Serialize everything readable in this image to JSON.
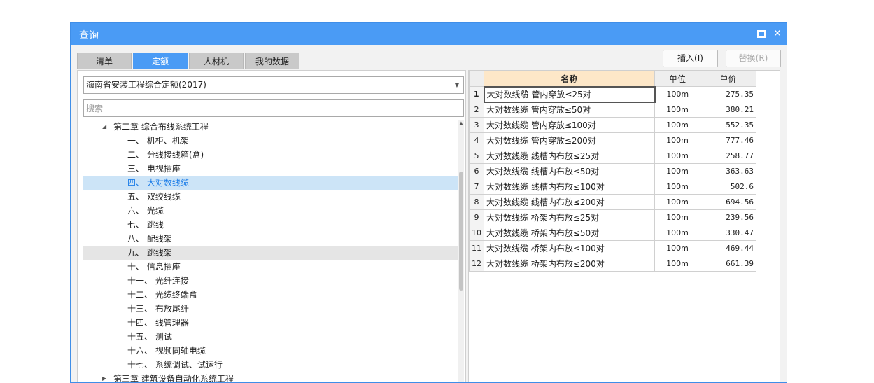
{
  "dialog": {
    "title": "查询",
    "maximize_label": "",
    "close_label": "✕"
  },
  "tabs": [
    {
      "label": "清单",
      "active": false
    },
    {
      "label": "定额",
      "active": true
    },
    {
      "label": "人材机",
      "active": false
    },
    {
      "label": "我的数据",
      "active": false
    }
  ],
  "actions": {
    "insert_label": "插入(I)",
    "replace_label": "替换(R)"
  },
  "library_select": {
    "value": "海南省安装工程综合定额(2017)"
  },
  "search": {
    "placeholder": "搜索"
  },
  "tree": {
    "chapter2": "第二章 综合布线系统工程",
    "items": [
      "一、 机柜、机架",
      "二、 分线接线箱(盒)",
      "三、 电视插座",
      "四、 大对数线缆",
      "五、 双绞线缆",
      "六、 光缆",
      "七、 跳线",
      "八、 配线架",
      "九、 跳线架",
      "十、 信息插座",
      "十一、 光纤连接",
      "十二、 光缆终端盒",
      "十三、 布放尾纤",
      "十四、 线管理器",
      "十五、 测试",
      "十六、 视频同轴电缆",
      "十七、 系统调试、试运行"
    ],
    "chapter3": "第三章 建筑设备自动化系统工程"
  },
  "grid": {
    "headers": {
      "name": "名称",
      "unit": "单位",
      "price": "单价"
    },
    "rows": [
      {
        "idx": "1",
        "name": "大对数线缆 管内穿放≤25对",
        "unit": "100m",
        "price": "275.35"
      },
      {
        "idx": "2",
        "name": "大对数线缆 管内穿放≤50对",
        "unit": "100m",
        "price": "380.21"
      },
      {
        "idx": "3",
        "name": "大对数线缆 管内穿放≤100对",
        "unit": "100m",
        "price": "552.35"
      },
      {
        "idx": "4",
        "name": "大对数线缆 管内穿放≤200对",
        "unit": "100m",
        "price": "777.46"
      },
      {
        "idx": "5",
        "name": "大对数线缆 线槽内布放≤25对",
        "unit": "100m",
        "price": "258.77"
      },
      {
        "idx": "6",
        "name": "大对数线缆 线槽内布放≤50对",
        "unit": "100m",
        "price": "363.63"
      },
      {
        "idx": "7",
        "name": "大对数线缆 线槽内布放≤100对",
        "unit": "100m",
        "price": "502.6"
      },
      {
        "idx": "8",
        "name": "大对数线缆 线槽内布放≤200对",
        "unit": "100m",
        "price": "694.56"
      },
      {
        "idx": "9",
        "name": "大对数线缆 桥架内布放≤25对",
        "unit": "100m",
        "price": "239.56"
      },
      {
        "idx": "10",
        "name": "大对数线缆 桥架内布放≤50对",
        "unit": "100m",
        "price": "330.47"
      },
      {
        "idx": "11",
        "name": "大对数线缆 桥架内布放≤100对",
        "unit": "100m",
        "price": "469.44"
      },
      {
        "idx": "12",
        "name": "大对数线缆 桥架内布放≤200对",
        "unit": "100m",
        "price": "661.39"
      }
    ]
  },
  "colors": {
    "titlebar": "#4a9bf5",
    "active_tab": "#4a9bf5",
    "selected_node_bg": "#cce4f7",
    "name_header_bg": "#fde7c8"
  }
}
